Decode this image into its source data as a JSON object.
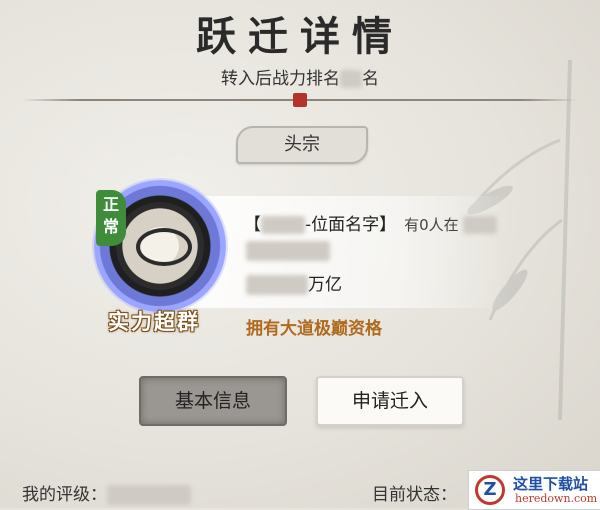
{
  "header": {
    "title": "跃迁详情",
    "subtitle_prefix": "转入后战力排名",
    "subtitle_suffix": "名"
  },
  "tag": {
    "label": "头宗"
  },
  "badge": {
    "rank_label": "正常",
    "power_label": "实力超群"
  },
  "info": {
    "plane_prefix": "【",
    "plane_suffix": "-位面名字】",
    "people_text": "有0人在",
    "power_suffix": "万亿",
    "qualify_text": "拥有大道极巅资格"
  },
  "buttons": {
    "basic_info": "基本信息",
    "apply_transfer": "申请迁入"
  },
  "footer": {
    "my_rating": "我的评级：",
    "current_status": "目前状态："
  },
  "watermark": {
    "logo": "Z",
    "name": "这里下载站",
    "domain": "heredown.com"
  },
  "colors": {
    "accent_orange": "#b06a1e",
    "seal_red": "#b3342b",
    "badge_green": "#3f8d3a",
    "badge_blue": "#6e78d6"
  }
}
